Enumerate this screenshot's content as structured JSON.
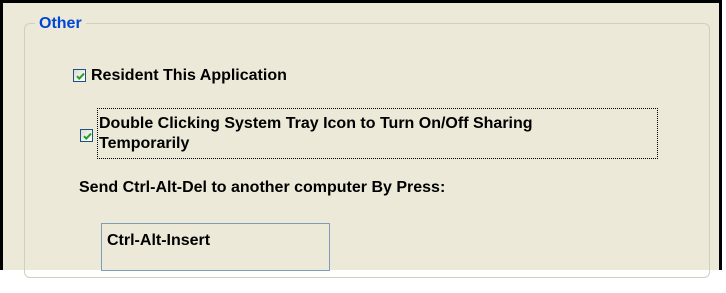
{
  "group": {
    "title": "Other"
  },
  "options": {
    "resident": {
      "label": "Resident This Application",
      "checked": true
    },
    "double_click": {
      "label_line1": "Double Clicking System Tray Icon to Turn On/Off Sharing",
      "label_line2": "Temporarily",
      "checked": true
    }
  },
  "hotkey": {
    "label": "Send Ctrl-Alt-Del to another computer By Press:",
    "value": "Ctrl-Alt-Insert"
  },
  "colors": {
    "title": "#0046d5",
    "check": "#21a121",
    "panel_bg": "#ece9d8",
    "checkbox_border": "#1c5180",
    "field_border": "#7f9db9"
  },
  "icons": {
    "checkmark": "check-icon"
  }
}
